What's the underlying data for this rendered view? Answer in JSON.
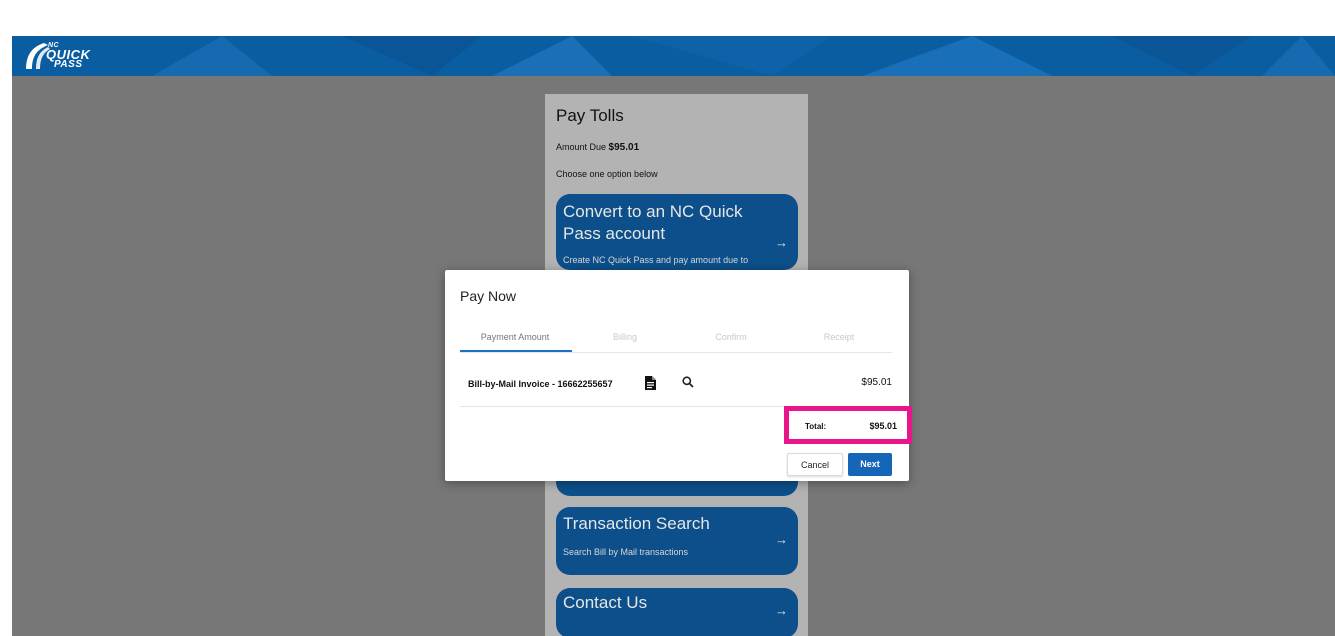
{
  "header": {
    "logo": {
      "line1": "NC",
      "line2": "QUICK",
      "line3": "PASS"
    }
  },
  "background": {
    "title": "Pay Tolls",
    "amount_due_label": "Amount Due",
    "amount_due_value": "$95.01",
    "choose_text": "Choose one option below",
    "options": [
      {
        "title": "Convert to an NC Quick Pass account",
        "subtitle": "Create NC Quick Pass and pay amount due to"
      },
      {
        "title": "Transaction Search",
        "subtitle": "Search Bill by Mail transactions"
      },
      {
        "title": "Contact Us",
        "subtitle": ""
      }
    ]
  },
  "modal": {
    "title": "Pay Now",
    "tabs": [
      "Payment Amount",
      "Billing",
      "Confirm",
      "Receipt"
    ],
    "active_tab": 0,
    "invoice": {
      "label": "Bill-by-Mail Invoice - 16662255657",
      "amount": "$95.01"
    },
    "total_label": "Total:",
    "total_value": "$95.01",
    "cancel_label": "Cancel",
    "next_label": "Next"
  },
  "colors": {
    "brand_blue": "#0b5da2",
    "highlight": "#e8168a",
    "primary_button": "#1565b8"
  },
  "icons": [
    "logo-swoosh-icon",
    "document-icon",
    "search-icon",
    "arrow-right-icon"
  ]
}
